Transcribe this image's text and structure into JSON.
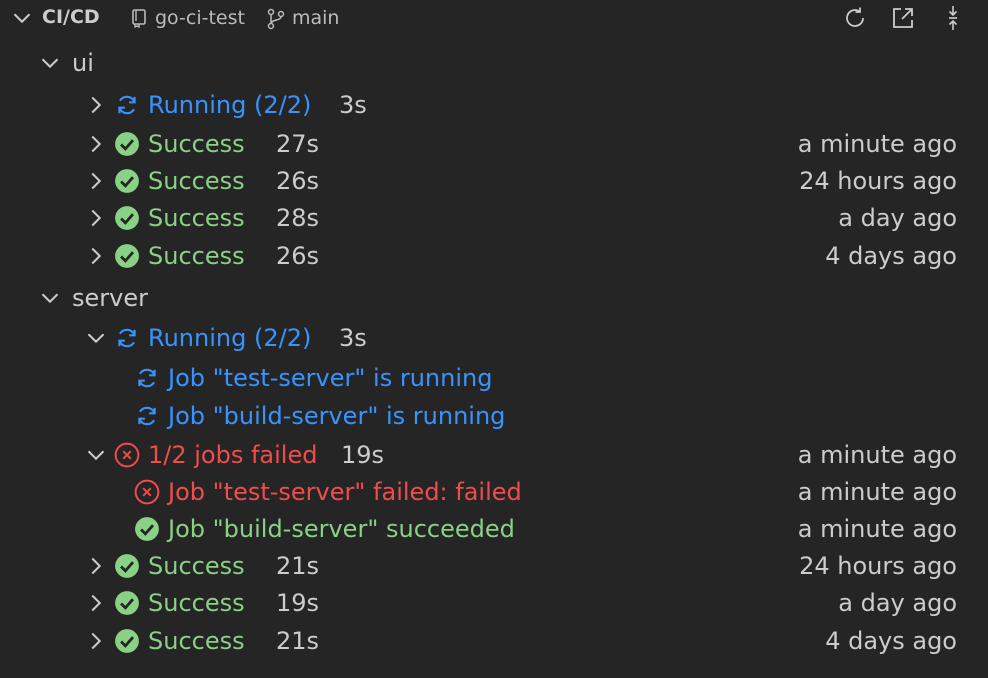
{
  "header": {
    "title": "CI/CD",
    "repo": "go-ci-test",
    "branch": "main",
    "actions": [
      "refresh-icon",
      "open-external-icon",
      "collapse-all-icon"
    ]
  },
  "colors": {
    "running": "#3794ff",
    "success": "#89d185",
    "failed": "#f14c4c",
    "text": "#cccccc",
    "background": "#252526"
  },
  "groups": {
    "ui": {
      "label": "ui",
      "rows": [
        {
          "status": "Running (2/2)",
          "duration": "3s",
          "time": ""
        },
        {
          "status": "Success",
          "duration": "27s",
          "time": "a minute ago"
        },
        {
          "status": "Success",
          "duration": "26s",
          "time": "24 hours ago"
        },
        {
          "status": "Success",
          "duration": "28s",
          "time": "a day ago"
        },
        {
          "status": "Success",
          "duration": "26s",
          "time": "4 days ago"
        }
      ]
    },
    "server": {
      "label": "server",
      "running": {
        "status": "Running (2/2)",
        "duration": "3s",
        "jobs": [
          "Job \"test-server\" is running",
          "Job \"build-server\" is running"
        ]
      },
      "failed": {
        "status": "1/2 jobs failed",
        "duration": "19s",
        "time": "a minute ago",
        "jobs": [
          {
            "label": "Job \"test-server\" failed: failed",
            "time": "a minute ago"
          },
          {
            "label": "Job \"build-server\" succeeded",
            "time": "a minute ago"
          }
        ]
      },
      "rows": [
        {
          "status": "Success",
          "duration": "21s",
          "time": "24 hours ago"
        },
        {
          "status": "Success",
          "duration": "19s",
          "time": "a day ago"
        },
        {
          "status": "Success",
          "duration": "21s",
          "time": "4 days ago"
        }
      ]
    }
  }
}
